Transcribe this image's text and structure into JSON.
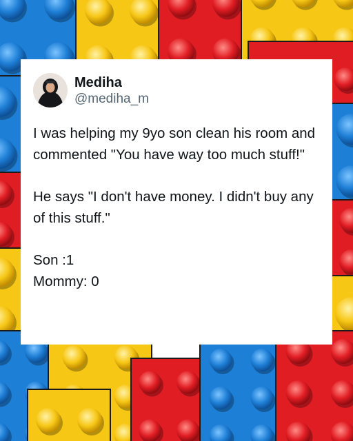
{
  "post": {
    "author": {
      "display_name": "Mediha",
      "handle": "@mediha_m",
      "avatar_icon": "profile-avatar"
    },
    "paragraphs": [
      "I was helping my 9yo son clean his room and commented \"You have way too much stuff!\"",
      "He says \"I don't have money. I didn't buy any of this stuff.\""
    ],
    "score_lines": [
      "Son :1",
      "Mommy: 0"
    ]
  },
  "background": {
    "description_icon": "lego-bricks-background",
    "colors": {
      "blue": "#1e7fd6",
      "yellow": "#f7c716",
      "red": "#e11d24"
    }
  }
}
